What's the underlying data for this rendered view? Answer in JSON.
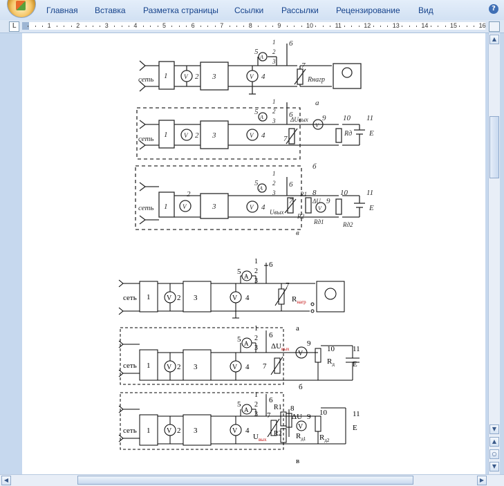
{
  "ribbon": {
    "tabs": [
      "Главная",
      "Вставка",
      "Разметка страницы",
      "Ссылки",
      "Рассылки",
      "Рецензирование",
      "Вид"
    ],
    "help_icon": "help-icon"
  },
  "ruler": {
    "tab_selector": "L",
    "numbers": [
      "1",
      "2",
      "3",
      "4",
      "5",
      "6",
      "7",
      "8",
      "9",
      "10",
      "11",
      "12",
      "13",
      "14",
      "15",
      "16"
    ]
  },
  "scan_figure": {
    "net_label": "сеть",
    "blocks": {
      "b1": "1",
      "b2": "2",
      "b3": "3",
      "b4": "4",
      "b5": "5",
      "b6": "6",
      "b7": "7",
      "b8": "8",
      "b9": "9",
      "b10": "10",
      "b11": "11"
    },
    "switch_positions": [
      "1",
      "2",
      "3"
    ],
    "ammeter": "A",
    "voltmeter": "V",
    "r_load": "Rнагр",
    "delta_u_out": "ΔUвых",
    "delta_u": "ΔU",
    "u_out": "Uвых",
    "r_d": "Rд",
    "r_d1": "Rд1",
    "r_d2": "Rд2",
    "r1": "R1",
    "r2": "R2",
    "e": "E",
    "captions": [
      "а",
      "б",
      "в"
    ]
  },
  "redraw_figure": {
    "net_label": "сеть",
    "switch_positions": [
      "1",
      "2",
      "3"
    ],
    "ammeter": "A",
    "voltmeter": "V",
    "r_load_main": "R",
    "r_load_sub": "нагр",
    "delta_u_main": "ΔU",
    "delta_u_sub": "вых",
    "r_d_main": "R",
    "r_d_sub": "д",
    "r_d1_main": "R",
    "r_d1_sub": "д1",
    "r_d2_main": "R",
    "r_d2_sub": "д2",
    "u_out_main": "U",
    "u_out_sub": "вых",
    "r1": "R1",
    "r2": "R2",
    "e": "E",
    "delta_u_plain": "ΔU",
    "captions": [
      "а",
      "б",
      "в"
    ]
  },
  "colors": {
    "ribbon_text": "#15428b",
    "workspace": "#c6d8ee"
  }
}
